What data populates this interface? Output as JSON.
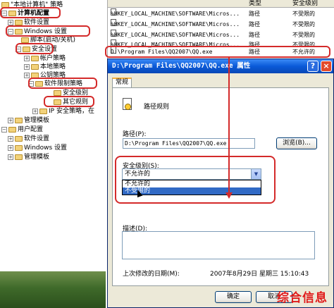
{
  "tree": {
    "root_label": "\"本地计算机\" 策略",
    "computer_config": "计算机配置",
    "software_settings": "软件设置",
    "windows_settings": "Windows 设置",
    "scripts": "脚本(启动/关机)",
    "security_settings": "安全设置",
    "account_policies": "帐户策略",
    "local_policies": "本地策略",
    "public_key_policies": "公钥策略",
    "software_restriction": "软件限制策略",
    "security_levels": "安全级别",
    "other_rules": "其它规则",
    "ip_security": "IP 安全策略，在",
    "admin_templates": "管理模板",
    "user_config": "用户配置",
    "user_software_settings": "软件设置",
    "user_windows_settings": "Windows 设置",
    "user_admin_templates": "管理模板"
  },
  "list": {
    "col_type": "类型",
    "col_security_level": "安全级别",
    "rows": [
      {
        "path": "%HKEY_LOCAL_MACHINE\\SOFTWARE\\Micros...",
        "type": "路径",
        "level": "不受限的"
      },
      {
        "path": "%HKEY_LOCAL_MACHINE\\SOFTWARE\\Micros...",
        "type": "路径",
        "level": "不受限的"
      },
      {
        "path": "%HKEY_LOCAL_MACHINE\\SOFTWARE\\Micros...",
        "type": "路径",
        "level": "不受限的"
      },
      {
        "path": "%HKEY_LOCAL_MACHINE\\SOFTWARE\\Micros...",
        "type": "路径",
        "level": "不受限的"
      },
      {
        "path": "D:\\Program Files\\QQ2007\\QQ.exe",
        "type": "路径",
        "level": "不允许的"
      }
    ]
  },
  "dialog": {
    "title": "D:\\Program Files\\QQ2007\\QQ.exe 属性",
    "help": "?",
    "close": "×",
    "tab_general": "常规",
    "rule_name": "路径规则",
    "path_label": "路径(P):",
    "path_value": "D:\\Program Files\\QQ2007\\QQ.exe",
    "browse": "浏览(B)...",
    "security_level_label": "安全级别(S):",
    "security_level_value": "不允许的",
    "options": [
      "不允许的",
      "不受限的"
    ],
    "description_label": "描述(D):",
    "last_modified_label": "上次修改的日期(M):",
    "last_modified_value": "2007年8月29日 星期三  15:10:43",
    "ok": "确定",
    "cancel": "取消"
  },
  "watermark": "综合信息",
  "colors": {
    "annotation": "#d42a2a",
    "title_bar": "#0a5ad8",
    "selection": "#316ac5"
  }
}
